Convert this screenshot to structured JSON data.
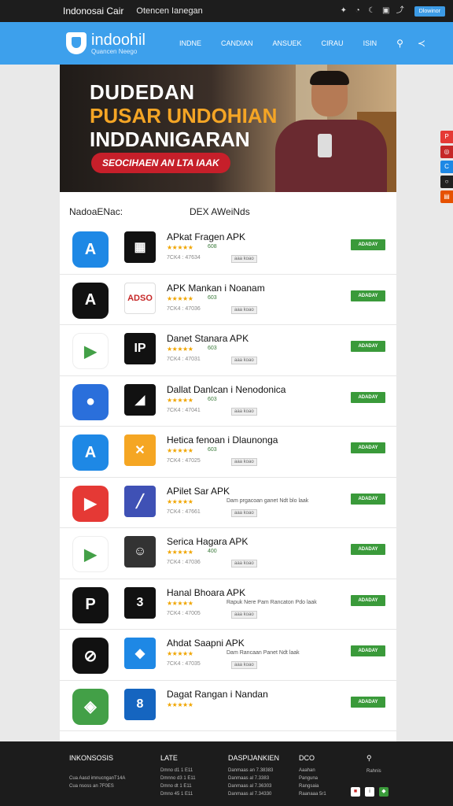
{
  "topbar": {
    "title": "Indonosai Cair",
    "subtitle": "Otencen Ianegan",
    "button": "Dlowinor",
    "icons": [
      "twitter-icon",
      "compass-icon",
      "moon-icon",
      "app-icon",
      "share-icon"
    ]
  },
  "header": {
    "logo": "indoohil",
    "logo_sub": "Quancen Neego",
    "nav": [
      "INDNE",
      "CANDIAN",
      "ANSUEK",
      "CIRAU",
      "ISIN"
    ],
    "icons": [
      "search-icon",
      "share-icon"
    ]
  },
  "banner": {
    "line1": "DUDEDAN",
    "line2": "PUSAR UNDOHIAN",
    "line3": "INDDANIGARAN",
    "pill": "SEOCIHAEN AN LTA IAAK"
  },
  "section": {
    "left": "NadoaENac:",
    "right": "DEX AWeiNds"
  },
  "apps": [
    {
      "name": "APkat Fragen APK",
      "rating": "608",
      "desc": "",
      "meta": "7CK4 : 47634",
      "tag": "aaa koao",
      "dl": "ADADAY",
      "c1": "#1e88e5",
      "g1": "A",
      "c2": "#111",
      "g2": "▦",
      "t2": "#fff"
    },
    {
      "name": "APK Mankan i Noanam",
      "rating": "603",
      "desc": "",
      "meta": "7CK4 : 47036",
      "tag": "aaa koao",
      "dl": "ADADAY",
      "c1": "#111",
      "g1": "A",
      "c2": "#fff",
      "g2": "ADSO",
      "t2": "#c62828"
    },
    {
      "name": "Danet Stanara APK",
      "rating": "603",
      "desc": "",
      "meta": "7CK4 : 47031",
      "tag": "aaa koao",
      "dl": "ADADAY",
      "c1": "#fff",
      "g1": "▶",
      "c2": "#111",
      "g2": "IP",
      "t2": "#fff"
    },
    {
      "name": "Dallat Danlcan i Nenodonica",
      "rating": "603",
      "desc": "",
      "meta": "7CK4 : 47041",
      "tag": "aaa koao",
      "dl": "ADADAY",
      "c1": "#2a6fdb",
      "g1": "●",
      "c2": "#111",
      "g2": "◢",
      "t2": "#fff"
    },
    {
      "name": "Hetica fenoan i Dlaunonga",
      "rating": "603",
      "desc": "",
      "meta": "7CK4 : 47025",
      "tag": "aaa koao",
      "dl": "ADADAY",
      "c1": "#1e88e5",
      "g1": "A",
      "c2": "#f5a623",
      "g2": "✕",
      "t2": "#fff"
    },
    {
      "name": "APilet Sar APK",
      "rating": "",
      "desc": "Dam prgacoan ganet Ndt blo laak",
      "meta": "7CK4 : 47661",
      "tag": "aaa koao",
      "dl": "ADADAY",
      "c1": "#e53935",
      "g1": "▶",
      "c2": "#3f51b5",
      "g2": "╱",
      "t2": "#fff"
    },
    {
      "name": "Serica Hagara APK",
      "rating": "400",
      "desc": "",
      "meta": "7CK4 : 47036",
      "tag": "aaa koao",
      "dl": "ADADAY",
      "c1": "#fff",
      "g1": "▶",
      "c2": "#333",
      "g2": "☺",
      "t2": "#fff"
    },
    {
      "name": "Hanal Bhoara APK",
      "rating": "",
      "desc": "Rapuk Nere Pam Rancaton Pdo laak",
      "meta": "7CK4 : 47005",
      "tag": "aaa koao",
      "dl": "ADADAY",
      "c1": "#111",
      "g1": "P",
      "c2": "#111",
      "g2": "3",
      "t2": "#fff"
    },
    {
      "name": "Ahdat Saapni APK",
      "rating": "",
      "desc": "Dam Rancaan Panet Ndt laak",
      "meta": "7CK4 : 47035",
      "tag": "aaa koao",
      "dl": "ADADAY",
      "c1": "#111",
      "g1": "⊘",
      "c2": "#1e88e5",
      "g2": "◆",
      "t2": "#fff"
    },
    {
      "name": "Dagat Rangan i Nandan",
      "rating": "",
      "desc": "",
      "meta": "",
      "tag": "",
      "dl": "ADADAY",
      "c1": "#43a047",
      "g1": "◈",
      "c2": "#1565c0",
      "g2": "8",
      "t2": "#fff"
    }
  ],
  "social": [
    {
      "icon": "pinterest-icon",
      "color": "#e53935",
      "glyph": "P"
    },
    {
      "icon": "instagram-icon",
      "color": "#c62828",
      "glyph": "◎"
    },
    {
      "icon": "web-icon",
      "color": "#1e88e5",
      "glyph": "C"
    },
    {
      "icon": "whatsapp-icon",
      "color": "#212121",
      "glyph": "○"
    },
    {
      "icon": "rss-icon",
      "color": "#e65100",
      "glyph": "▤"
    }
  ],
  "footer": {
    "col1": {
      "head": "INKONSOSIS",
      "items": [
        "Cua Aasd imnucnganT14A",
        "Cua nsoss an 7F0ES"
      ]
    },
    "col2": {
      "head": "LATE",
      "items": [
        "Dmno d1 1 E11",
        "Dmnno d3 1 E11",
        "Dmno dt 1 E11",
        "Dmno 45 1 E11"
      ]
    },
    "col3": {
      "head": "DASPIJANKIEN",
      "items": [
        "Danmaas an 7.38383",
        "Danmaas al 7.3383",
        "Danmaas al 7.36303",
        "Danmaas al 7.34330"
      ]
    },
    "col4": {
      "head": "DCO",
      "items": [
        "Aaahan",
        "Panguna",
        "Rangsaia",
        "Raanaaa 5r1"
      ]
    },
    "col5": {
      "head": "",
      "items": [
        "Rahnis"
      ]
    }
  }
}
